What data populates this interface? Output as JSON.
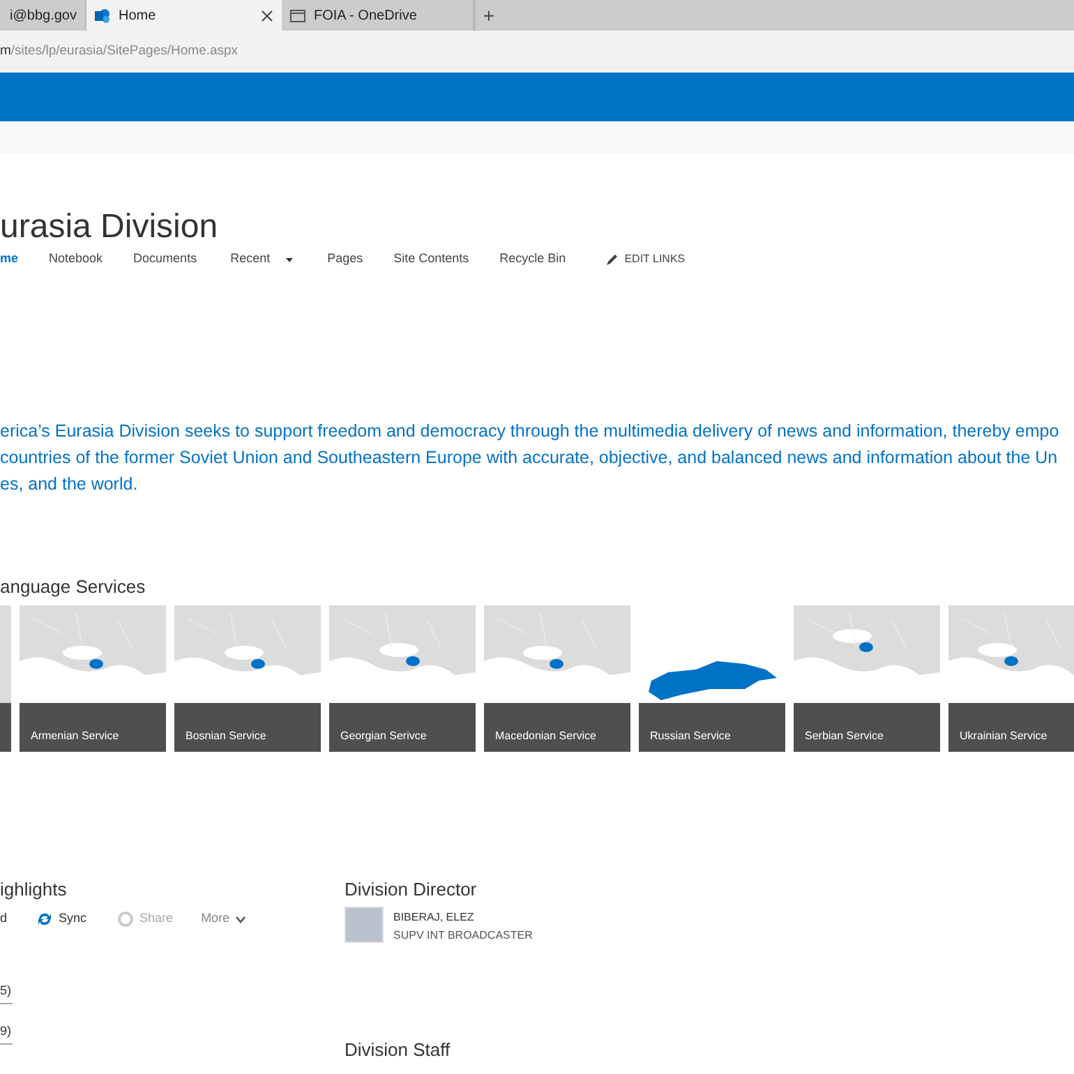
{
  "browser_tabs": [
    {
      "label": "i@bbg.gov",
      "selected": false,
      "closable": false
    },
    {
      "label": "Home",
      "selected": true,
      "closable": true
    },
    {
      "label": "FOIA - OneDrive",
      "selected": false,
      "closable": false
    }
  ],
  "new_tab": "+",
  "address": {
    "host_part": "m",
    "path": "/sites/lp/eurasia/SitePages/Home.aspx"
  },
  "site_title": "urasia Division",
  "nav": [
    {
      "label": "me",
      "selected": true,
      "dropdown": false
    },
    {
      "label": "Notebook",
      "selected": false,
      "dropdown": false
    },
    {
      "label": "Documents",
      "selected": false,
      "dropdown": false
    },
    {
      "label": "Recent",
      "selected": false,
      "dropdown": true
    },
    {
      "label": "Pages",
      "selected": false,
      "dropdown": false
    },
    {
      "label": "Site Contents",
      "selected": false,
      "dropdown": false
    },
    {
      "label": "Recycle Bin",
      "selected": false,
      "dropdown": false
    }
  ],
  "edit_links": "EDIT LINKS",
  "description": [
    "erica’s Eurasia Division seeks to support freedom and democracy through the multimedia delivery of news and information, thereby empo",
    "countries of the former Soviet Union and Southeastern Europe with accurate, objective, and balanced news and information about the Un",
    "es, and the world."
  ],
  "language_services": {
    "heading": "anguage Services",
    "tiles": [
      {
        "label": "Armenian Service"
      },
      {
        "label": "Bosnian Service"
      },
      {
        "label": "Georgian Serivce"
      },
      {
        "label": "Macedonian Service"
      },
      {
        "label": "Russian Service"
      },
      {
        "label": "Serbian Service"
      },
      {
        "label": "Ukrainian Service"
      }
    ]
  },
  "highlights": {
    "heading": "ighlights",
    "toolbar": [
      {
        "kind": "text",
        "label": "d",
        "disabled": false
      },
      {
        "kind": "sync",
        "label": "Sync",
        "disabled": false
      },
      {
        "kind": "share",
        "label": "Share",
        "disabled": true
      },
      {
        "kind": "more",
        "label": "More",
        "disabled": false
      }
    ],
    "items": [
      "5)",
      "9)"
    ]
  },
  "director": {
    "heading": "Division Director",
    "name": "BIBERAJ, ELEZ",
    "job_title": "SUPV INT BROADCASTER"
  },
  "staff": {
    "heading": "Division Staff"
  }
}
